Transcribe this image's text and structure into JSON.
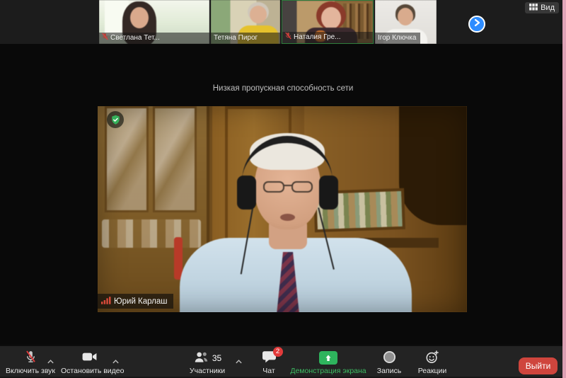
{
  "top_bar": {
    "view_label": "Вид",
    "thumbnails": [
      {
        "name": "Светлана Тет...",
        "muted": true
      },
      {
        "name": "Тетяна Пирог",
        "muted": false
      },
      {
        "name": "Наталия Гре...",
        "muted": true
      },
      {
        "name": "Ігор Ключка",
        "muted": false
      }
    ]
  },
  "main": {
    "warning": "Низкая пропускная способность сети",
    "speaker_name": "Юрий Карлаш"
  },
  "toolbar": {
    "unmute_label": "Включить звук",
    "stop_video_label": "Остановить видео",
    "participants_label": "Участники",
    "participants_count": "35",
    "chat_label": "Чат",
    "chat_badge": "2",
    "share_label": "Демонстрация экрана",
    "record_label": "Запись",
    "reactions_label": "Реакции",
    "leave_label": "Выйти"
  },
  "colors": {
    "accent_green": "#2eb45d",
    "zoom_blue": "#2d8cff",
    "leave_red": "#cf453d",
    "badge_red": "#e23b3b",
    "mute_red": "#e03c3c"
  }
}
